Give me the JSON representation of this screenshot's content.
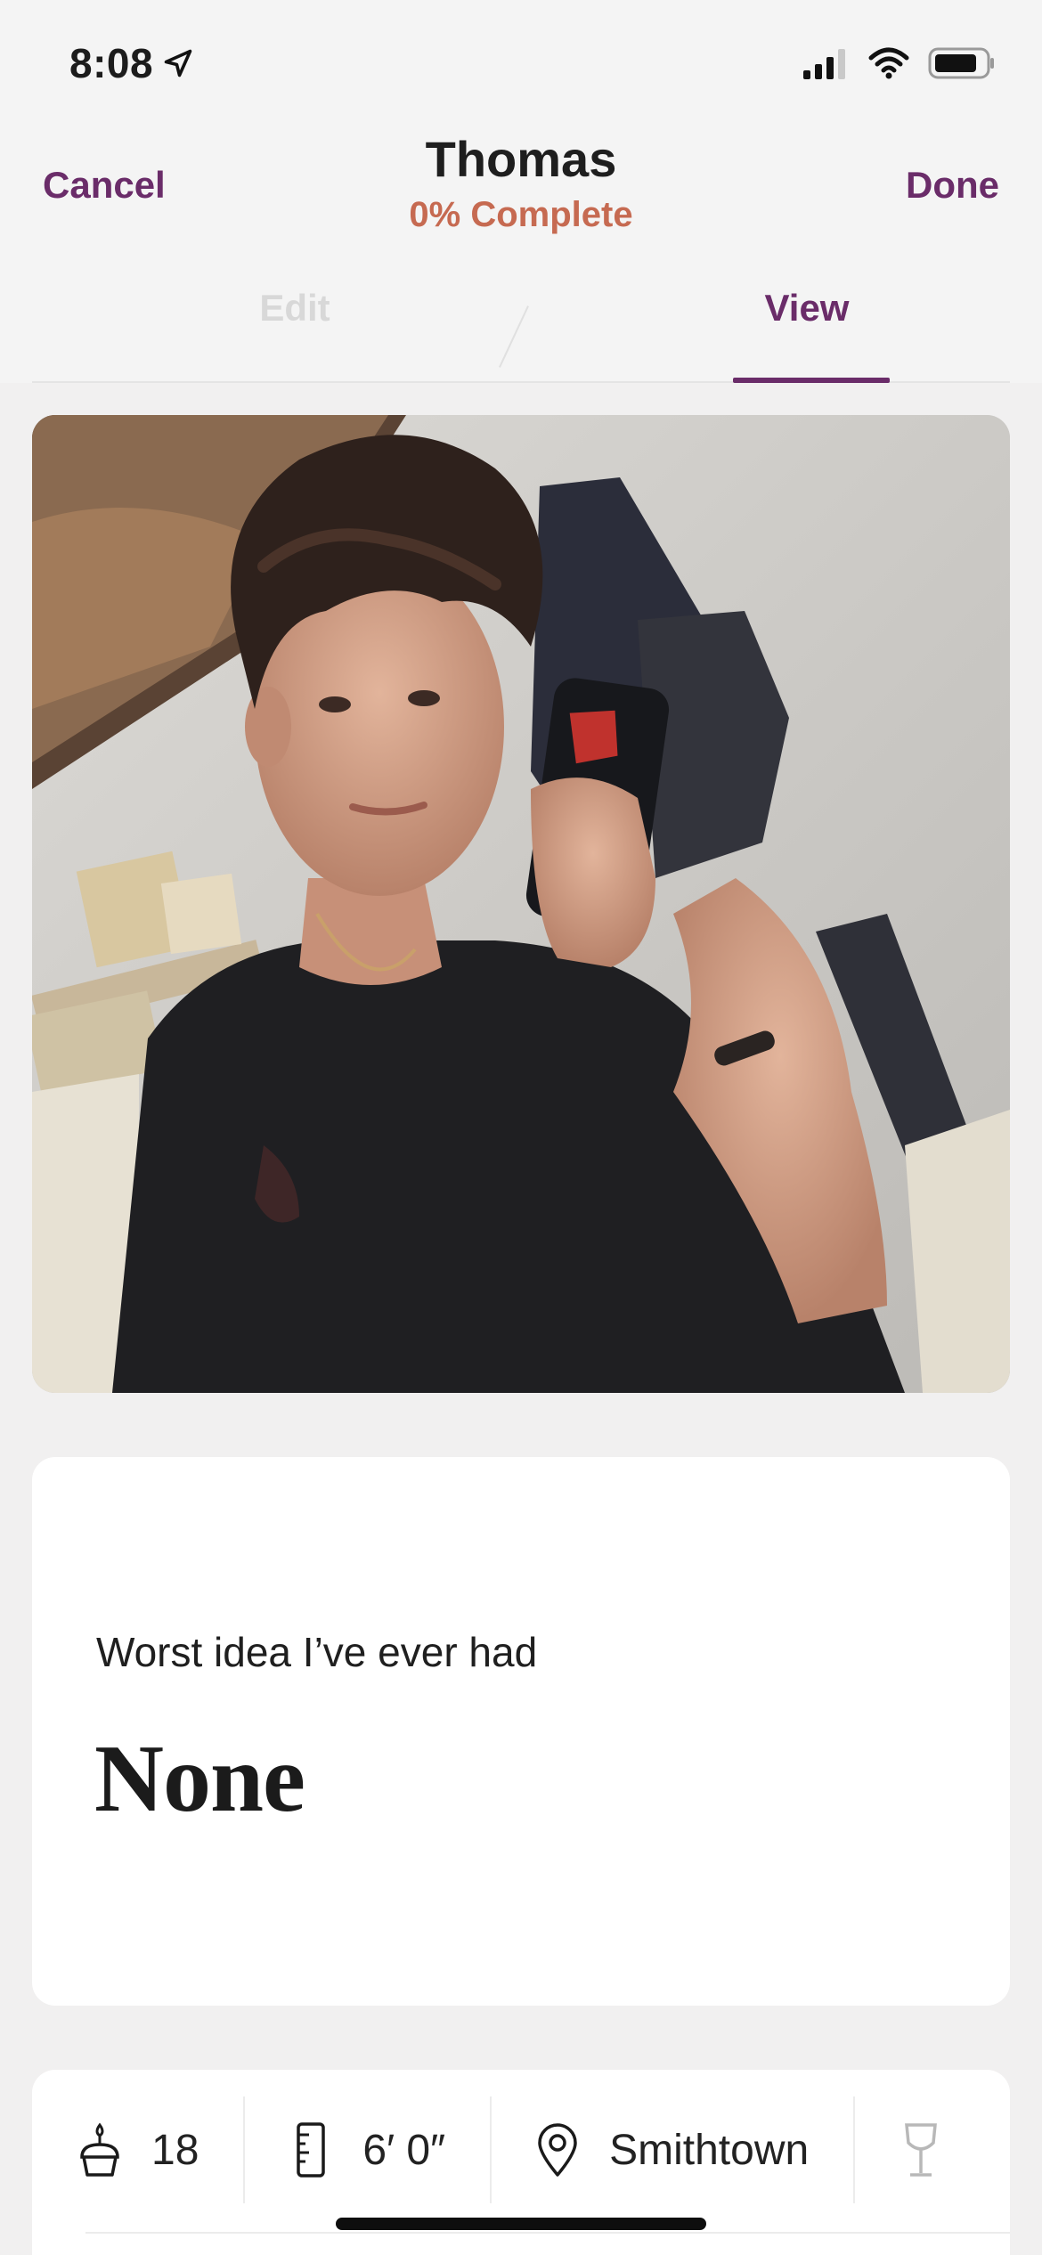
{
  "status_bar": {
    "time": "8:08",
    "icons": [
      "location-arrow-icon",
      "signal-icon",
      "wifi-icon",
      "battery-icon"
    ]
  },
  "header": {
    "cancel_label": "Cancel",
    "done_label": "Done",
    "profile_name": "Thomas",
    "completion": "0% Complete"
  },
  "tabs": [
    {
      "label": "Edit",
      "active": false
    },
    {
      "label": "View",
      "active": true
    }
  ],
  "prompt": {
    "question": "Worst idea I’ve ever had",
    "answer": "None"
  },
  "vitals": {
    "age": "18",
    "height": "6′ 0″",
    "location": "Smithtown"
  },
  "colors": {
    "accent": "#6a2c69",
    "completion": "#c66a51",
    "background": "#f1f0f0"
  }
}
